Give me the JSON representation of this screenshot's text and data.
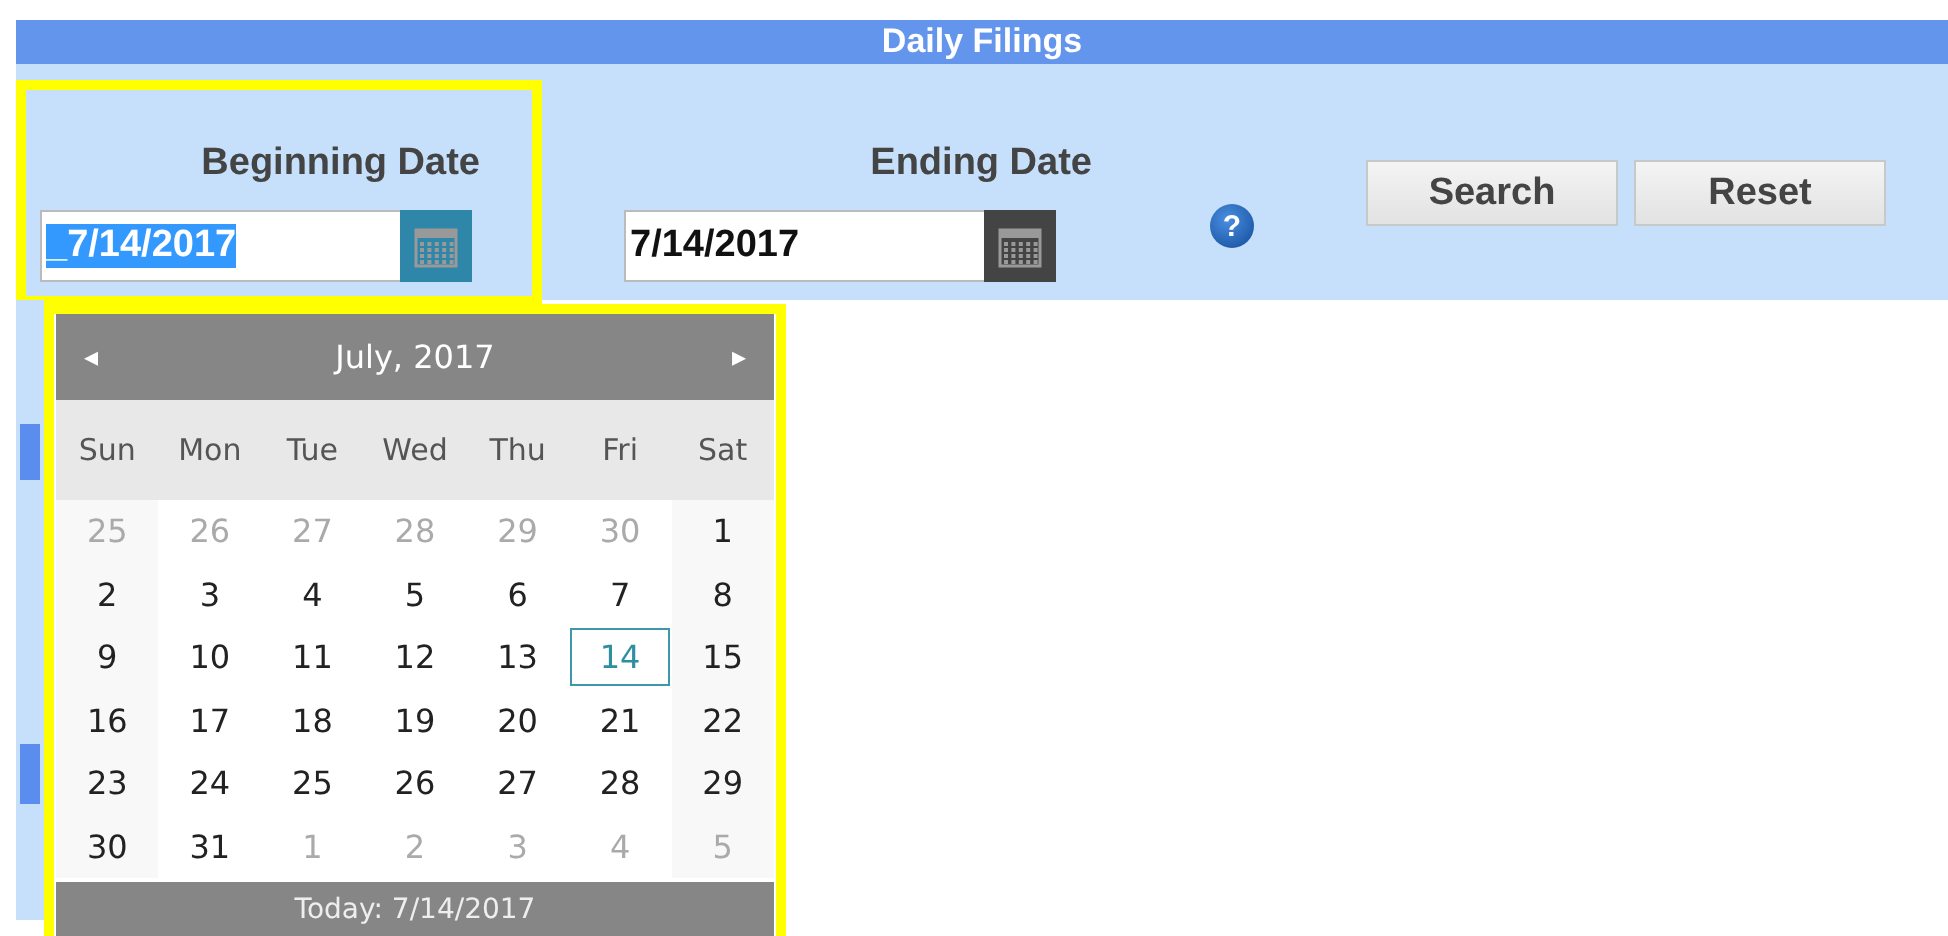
{
  "header": {
    "title": "Daily Filings"
  },
  "filters": [
    {
      "label": "Beginning Date",
      "value": "_7/14/2017",
      "text_selected": true,
      "calendar_open": true,
      "highlighted": true
    },
    {
      "label": "Ending Date",
      "value": "7/14/2017",
      "text_selected": false,
      "calendar_open": false
    }
  ],
  "help": {
    "icon": "?"
  },
  "buttons": [
    "Search",
    "Reset"
  ],
  "calendar": {
    "highlighted": true,
    "prev": "◂",
    "next": "▸",
    "month": "July, 2017",
    "weekdays": [
      "Sun",
      "Mon",
      "Tue",
      "Wed",
      "Thu",
      "Fri",
      "Sat"
    ],
    "weeks": [
      [
        {
          "day": "25",
          "other_month": true,
          "selected": false
        },
        {
          "day": "26",
          "other_month": true,
          "selected": false
        },
        {
          "day": "27",
          "other_month": true,
          "selected": false
        },
        {
          "day": "28",
          "other_month": true,
          "selected": false
        },
        {
          "day": "29",
          "other_month": true,
          "selected": false
        },
        {
          "day": "30",
          "other_month": true,
          "selected": false
        },
        {
          "day": "1",
          "other_month": false,
          "selected": false
        }
      ],
      [
        {
          "day": "2",
          "other_month": false,
          "selected": false
        },
        {
          "day": "3",
          "other_month": false,
          "selected": false
        },
        {
          "day": "4",
          "other_month": false,
          "selected": false
        },
        {
          "day": "5",
          "other_month": false,
          "selected": false
        },
        {
          "day": "6",
          "other_month": false,
          "selected": false
        },
        {
          "day": "7",
          "other_month": false,
          "selected": false
        },
        {
          "day": "8",
          "other_month": false,
          "selected": false
        }
      ],
      [
        {
          "day": "9",
          "other_month": false,
          "selected": false
        },
        {
          "day": "10",
          "other_month": false,
          "selected": false
        },
        {
          "day": "11",
          "other_month": false,
          "selected": false
        },
        {
          "day": "12",
          "other_month": false,
          "selected": false
        },
        {
          "day": "13",
          "other_month": false,
          "selected": false
        },
        {
          "day": "14",
          "other_month": false,
          "selected": true
        },
        {
          "day": "15",
          "other_month": false,
          "selected": false
        }
      ],
      [
        {
          "day": "16",
          "other_month": false,
          "selected": false
        },
        {
          "day": "17",
          "other_month": false,
          "selected": false
        },
        {
          "day": "18",
          "other_month": false,
          "selected": false
        },
        {
          "day": "19",
          "other_month": false,
          "selected": false
        },
        {
          "day": "20",
          "other_month": false,
          "selected": false
        },
        {
          "day": "21",
          "other_month": false,
          "selected": false
        },
        {
          "day": "22",
          "other_month": false,
          "selected": false
        }
      ],
      [
        {
          "day": "23",
          "other_month": false,
          "selected": false
        },
        {
          "day": "24",
          "other_month": false,
          "selected": false
        },
        {
          "day": "25",
          "other_month": false,
          "selected": false
        },
        {
          "day": "26",
          "other_month": false,
          "selected": false
        },
        {
          "day": "27",
          "other_month": false,
          "selected": false
        },
        {
          "day": "28",
          "other_month": false,
          "selected": false
        },
        {
          "day": "29",
          "other_month": false,
          "selected": false
        }
      ],
      [
        {
          "day": "30",
          "other_month": false,
          "selected": false
        },
        {
          "day": "31",
          "other_month": false,
          "selected": false
        },
        {
          "day": "1",
          "other_month": true,
          "selected": false
        },
        {
          "day": "2",
          "other_month": true,
          "selected": false
        },
        {
          "day": "3",
          "other_month": true,
          "selected": false
        },
        {
          "day": "4",
          "other_month": true,
          "selected": false
        },
        {
          "day": "5",
          "other_month": true,
          "selected": false
        }
      ]
    ],
    "today": "Today: 7/14/2017"
  }
}
